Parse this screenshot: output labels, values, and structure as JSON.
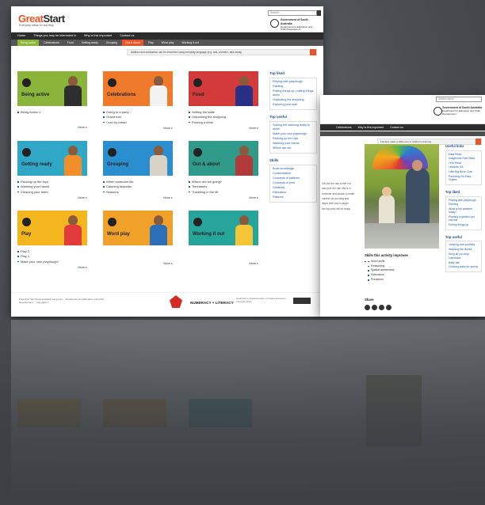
{
  "front": {
    "logo": {
      "great": "Great",
      "start": "Start",
      "tagline": "Everyday ideas for learning"
    },
    "search_placeholder": "Search...",
    "govt": {
      "line1": "Government of South Australia",
      "line2": "Department for Education and Child Development"
    },
    "nav": [
      "Home",
      "Things you may be interested in",
      "Why is this important",
      "Contact us"
    ],
    "subnav": [
      {
        "label": "Being active",
        "color": "#8ab43a"
      },
      {
        "label": "Celebrations",
        "color": "#555555"
      },
      {
        "label": "Food",
        "color": "#555555"
      },
      {
        "label": "Getting ready",
        "color": "#555555"
      },
      {
        "label": "Grouping",
        "color": "#555555"
      },
      {
        "label": "Out & about",
        "color": "#e8552a"
      },
      {
        "label": "Play",
        "color": "#555555"
      },
      {
        "label": "Word play",
        "color": "#555555"
      },
      {
        "label": "Working it out",
        "color": "#555555"
      }
    ],
    "banner": "Addition and subtraction can be described using everyday language (e.g. add, combine, take away)",
    "tiles": [
      {
        "title": "Being active",
        "color": "#8ab43a",
        "links": [
          "Being Active 1"
        ],
        "more": "More"
      },
      {
        "title": "Celebrations",
        "color": "#f07a2c",
        "links": [
          "Going to a party",
          "Grand trial",
          "I can try bread"
        ],
        "more": "More"
      },
      {
        "title": "Food",
        "color": "#d33b3b",
        "links": [
          "Setting the table",
          "Unpacking the shopping",
          "Pouring a drink"
        ],
        "more": "More"
      },
      {
        "title": "Getting ready",
        "color": "#30a7c6",
        "links": [
          "Packing up the toys",
          "Washing your hands",
          "Cleaning your teeth"
        ],
        "more": "More"
      },
      {
        "title": "Grouping",
        "color": "#2b8fcf",
        "links": [
          "When creatures life",
          "Catching tadpoles",
          "Seasons"
        ],
        "more": "More"
      },
      {
        "title": "Out & about",
        "color": "#2f9a8a",
        "links": [
          "Where are we going?",
          "Timetables",
          "Travelling in the lift"
        ],
        "more": "More"
      },
      {
        "title": "Play",
        "color": "#f4b61f",
        "links": [
          "Play 2",
          "Play 1",
          "Make your own playdough!"
        ],
        "more": "More"
      },
      {
        "title": "Word play",
        "color": "#f0a12a",
        "links": [],
        "more": "More"
      },
      {
        "title": "Working it out",
        "color": "#27a59b",
        "links": [],
        "more": "More"
      }
    ],
    "sidebar": {
      "top_liked": {
        "title": "Top liked",
        "items": [
          "Playing with playdough",
          "Painting",
          "Putting things up, putting things down",
          "Unpacking the shopping",
          "Exploring junk mail"
        ]
      },
      "top_useful": {
        "title": "Top useful",
        "items": [
          "Solving the washing ready to wear!",
          "Make your own playdough",
          "Packing up the toys",
          "Washing your hands",
          "Where are we"
        ]
      },
      "skills": {
        "title": "Skills",
        "items": [
          "Book knowledge",
          "Concentration",
          "Concepts of patterns",
          "Concepts of print",
          "Creativity",
          "Estimation",
          "Patterns"
        ]
      }
    },
    "footer": {
      "small_text": "Page link: http://www.greatstart.sa.gov.au ... Department for Education and Child Development ... Copyright ©",
      "numeracy": "NUMERACY",
      "literacy": "LITERACY",
      "right_text": "Great Start is licensed under a Creative Commons ... Copyright 2013"
    }
  },
  "back": {
    "search_placeholder": "Search items",
    "govt": {
      "line1": "Government of South Australia",
      "line2": "Department for Education and Child Development"
    },
    "nav": [
      "Celebrations",
      "Why is this important",
      "Contact us"
    ],
    "notice": "Families make a difference to children's learning",
    "left_text": [
      "Get the the rain a little in it",
      "and pour the rain into is in",
      "reminder and please to make",
      "number by counting and",
      "larger then and in larger",
      "the big ones will be ready"
    ],
    "skills": {
      "title": "Skills this activity improves",
      "items": [
        "Word skills",
        "Reasoning",
        "Spatial awareness",
        "Estimation",
        "Prediction"
      ]
    },
    "share": {
      "title": "Share"
    },
    "sidebar": {
      "useful_links": {
        "title": "Useful links",
        "items": [
          "Data Read",
          "Indigenous Kids Read",
          "Let's Read",
          "Libraries SA",
          "Little Big Book Club",
          "Parenting SA Easy Guides"
        ]
      },
      "top_liked": {
        "title": "Top liked",
        "items": [
          "Playing with playdough",
          "Painting",
          "What is the weather today?",
          "Planting a garden you can eat",
          "Putting things up"
        ]
      },
      "top_useful": {
        "title": "Top useful",
        "items": [
          "Jumping over puddles",
          "Washing the dishes",
          "Shop till you drop",
          "Calendars",
          "Baby talk",
          "Growing bulbs for spring"
        ]
      }
    }
  }
}
